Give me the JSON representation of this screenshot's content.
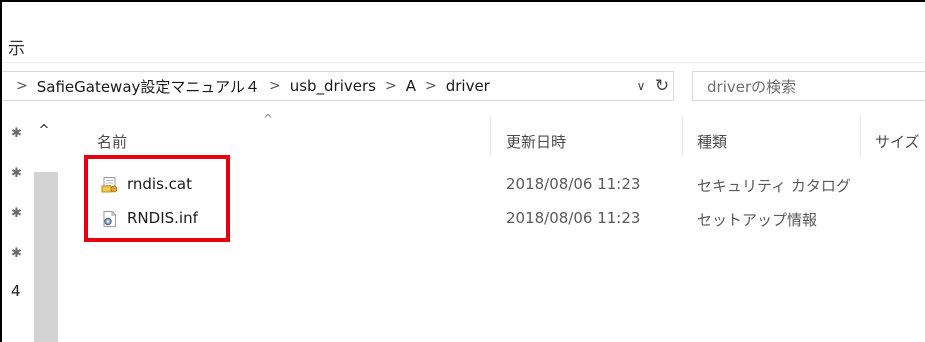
{
  "window": {
    "title_fragment": "示"
  },
  "address": {
    "crumbs": [
      {
        "label": "SafieGateway設定マニュアル４"
      },
      {
        "label": "usb_drivers"
      },
      {
        "label": "A"
      },
      {
        "label": "driver"
      }
    ],
    "separator": ">",
    "dropdown_glyph": "∨",
    "refresh_glyph": "↻"
  },
  "search": {
    "placeholder": "driverの検索"
  },
  "nav": {
    "scroll_up_glyph": "^",
    "pin_glyph": "✱",
    "item_fragment": "4"
  },
  "list": {
    "sort_caret": "^",
    "columns": [
      {
        "label": "名前"
      },
      {
        "label": "更新日時"
      },
      {
        "label": "種類"
      },
      {
        "label": "サイズ"
      }
    ],
    "rows": [
      {
        "name": "rndis.cat",
        "date": "2018/08/06 11:23",
        "type": "セキュリティ カタログ",
        "icon": "security-catalog-file-icon"
      },
      {
        "name": "RNDIS.inf",
        "date": "2018/08/06 11:23",
        "type": "セットアップ情報",
        "icon": "setup-info-file-icon"
      }
    ]
  },
  "colors": {
    "highlight": "#e60012",
    "scrollbar": "#d3d3d3"
  }
}
